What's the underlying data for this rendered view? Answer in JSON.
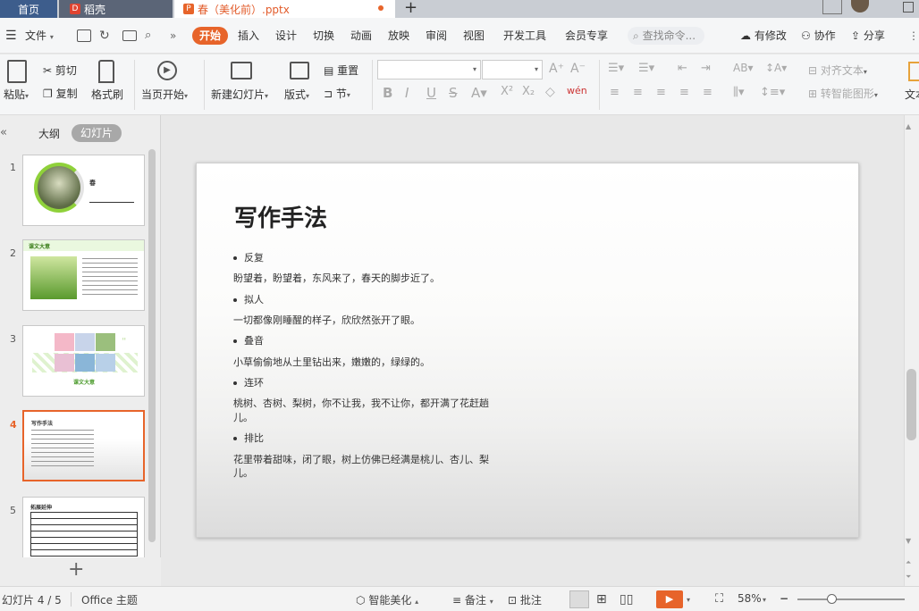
{
  "tabs": {
    "home": "首页",
    "daoke": "稻壳",
    "doc": "春（美化前）.pptx"
  },
  "menu": {
    "file": "文件",
    "items": [
      "开始",
      "插入",
      "设计",
      "切换",
      "动画",
      "放映",
      "审阅",
      "视图",
      "开发工具",
      "会员专享"
    ],
    "search": "查找命令...",
    "has_changes": "有修改",
    "collab": "协作",
    "share": "分享"
  },
  "ribbon": {
    "paste": "粘贴",
    "cut": "剪切",
    "copy": "复制",
    "format_painter": "格式刷",
    "from_current": "当页开始",
    "new_slide": "新建幻灯片",
    "layout": "版式",
    "reset": "重置",
    "section": "节",
    "align_text": "对齐文本",
    "to_smartart": "转智能图形",
    "text": "文本"
  },
  "panel": {
    "outline": "大纲",
    "slides": "幻灯片",
    "add": "+"
  },
  "thumbs": {
    "t1_title": "春",
    "t2_title": "课文大意",
    "t3_caption": "课文大意",
    "t4_title": "写作手法",
    "t5_title": "拓展延伸"
  },
  "slide": {
    "title": "写作手法",
    "items": [
      {
        "head": "反复",
        "body": [
          "盼望着，盼望着，东风来了，春天的脚步近了。"
        ]
      },
      {
        "head": "拟人",
        "body": [
          "一切都像刚睡醒的样子，欣欣然张开了眼。"
        ]
      },
      {
        "head": "叠音",
        "body": [
          "小草偷偷地从土里钻出来，嫩嫩的，绿绿的。"
        ]
      },
      {
        "head": "连环",
        "body": [
          "桃树、杏树、梨树，你不让我，我不让你，都开满了花赶趟",
          "儿。"
        ]
      },
      {
        "head": "排比",
        "body": [
          "花里带着甜味，闭了眼，树上仿佛已经满是桃儿、杏儿、梨",
          "儿。"
        ]
      }
    ]
  },
  "status": {
    "slide_info": "幻灯片 4 / 5",
    "theme": "Office 主题",
    "beautify": "智能美化",
    "notes": "备注",
    "comments": "批注",
    "zoom": "58%"
  },
  "colors": {
    "accent": "#e7642a",
    "tab_active": "#3d5d8c"
  },
  "selected_slide": 4,
  "slide_count": 5,
  "zoom_percent": 58
}
